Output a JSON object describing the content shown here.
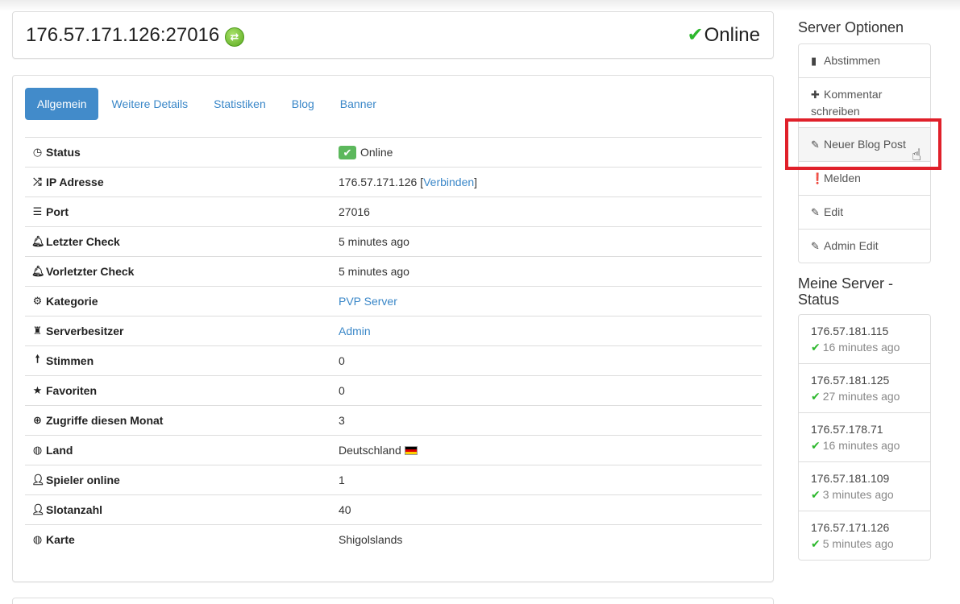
{
  "header": {
    "server_address": "176.57.171.126:27016",
    "connect_icon": "refresh-arrows-icon",
    "status_text": "Online",
    "status_color": "#2db82d"
  },
  "tabs": [
    {
      "label": "Allgemein",
      "active": true
    },
    {
      "label": "Weitere Details",
      "active": false
    },
    {
      "label": "Statistiken",
      "active": false
    },
    {
      "label": "Blog",
      "active": false
    },
    {
      "label": "Banner",
      "active": false
    }
  ],
  "info": {
    "status": {
      "label": "Status",
      "icon": "clock-icon",
      "value": "Online"
    },
    "ip": {
      "label": "IP Adresse",
      "icon": "shuffle-icon",
      "value": "176.57.171.126",
      "link_prefix": "[",
      "link": "Verbinden",
      "link_suffix": "]"
    },
    "port": {
      "label": "Port",
      "icon": "server-icon",
      "value": "27016"
    },
    "last_check": {
      "label": "Letzter Check",
      "icon": "bell-icon",
      "value": "5 minutes ago"
    },
    "prev_check": {
      "label": "Vorletzter Check",
      "icon": "bell-icon",
      "value": "5 minutes ago"
    },
    "category": {
      "label": "Kategorie",
      "icon": "gear-icon",
      "value": "PVP Server"
    },
    "owner": {
      "label": "Serverbesitzer",
      "icon": "crown-icon",
      "value": "Admin"
    },
    "votes": {
      "label": "Stimmen",
      "icon": "arrow-up-icon",
      "value": "0"
    },
    "favorites": {
      "label": "Favoriten",
      "icon": "star-icon",
      "value": "0"
    },
    "visits": {
      "label": "Zugriffe diesen Monat",
      "icon": "upload-circle-icon",
      "value": "3"
    },
    "country": {
      "label": "Land",
      "icon": "globe-icon",
      "value": "Deutschland"
    },
    "players": {
      "label": "Spieler online",
      "icon": "user-icon",
      "value": "1"
    },
    "slots": {
      "label": "Slotanzahl",
      "icon": "user-icon",
      "value": "40"
    },
    "map": {
      "label": "Karte",
      "icon": "globe-icon",
      "value": "Shigolslands"
    }
  },
  "sidebar": {
    "options_heading": "Server Optionen",
    "options": [
      {
        "label": "Abstimmen",
        "icon": "bar-chart-icon"
      },
      {
        "label": "Kommentar schreiben",
        "icon": "plus-icon"
      },
      {
        "label": "Neuer Blog Post",
        "icon": "pencil-icon"
      },
      {
        "label": "Melden",
        "icon": "exclamation-circle-icon"
      },
      {
        "label": "Edit",
        "icon": "pencil-icon"
      },
      {
        "label": "Admin Edit",
        "icon": "pencil-icon"
      }
    ],
    "my_servers_heading": "Meine Server - Status",
    "my_servers": [
      {
        "ip": "176.57.181.115",
        "time": "16 minutes ago"
      },
      {
        "ip": "176.57.181.125",
        "time": "27 minutes ago"
      },
      {
        "ip": "176.57.178.71",
        "time": "16 minutes ago"
      },
      {
        "ip": "176.57.181.109",
        "time": "3 minutes ago"
      },
      {
        "ip": "176.57.171.126",
        "time": "5 minutes ago"
      }
    ]
  }
}
